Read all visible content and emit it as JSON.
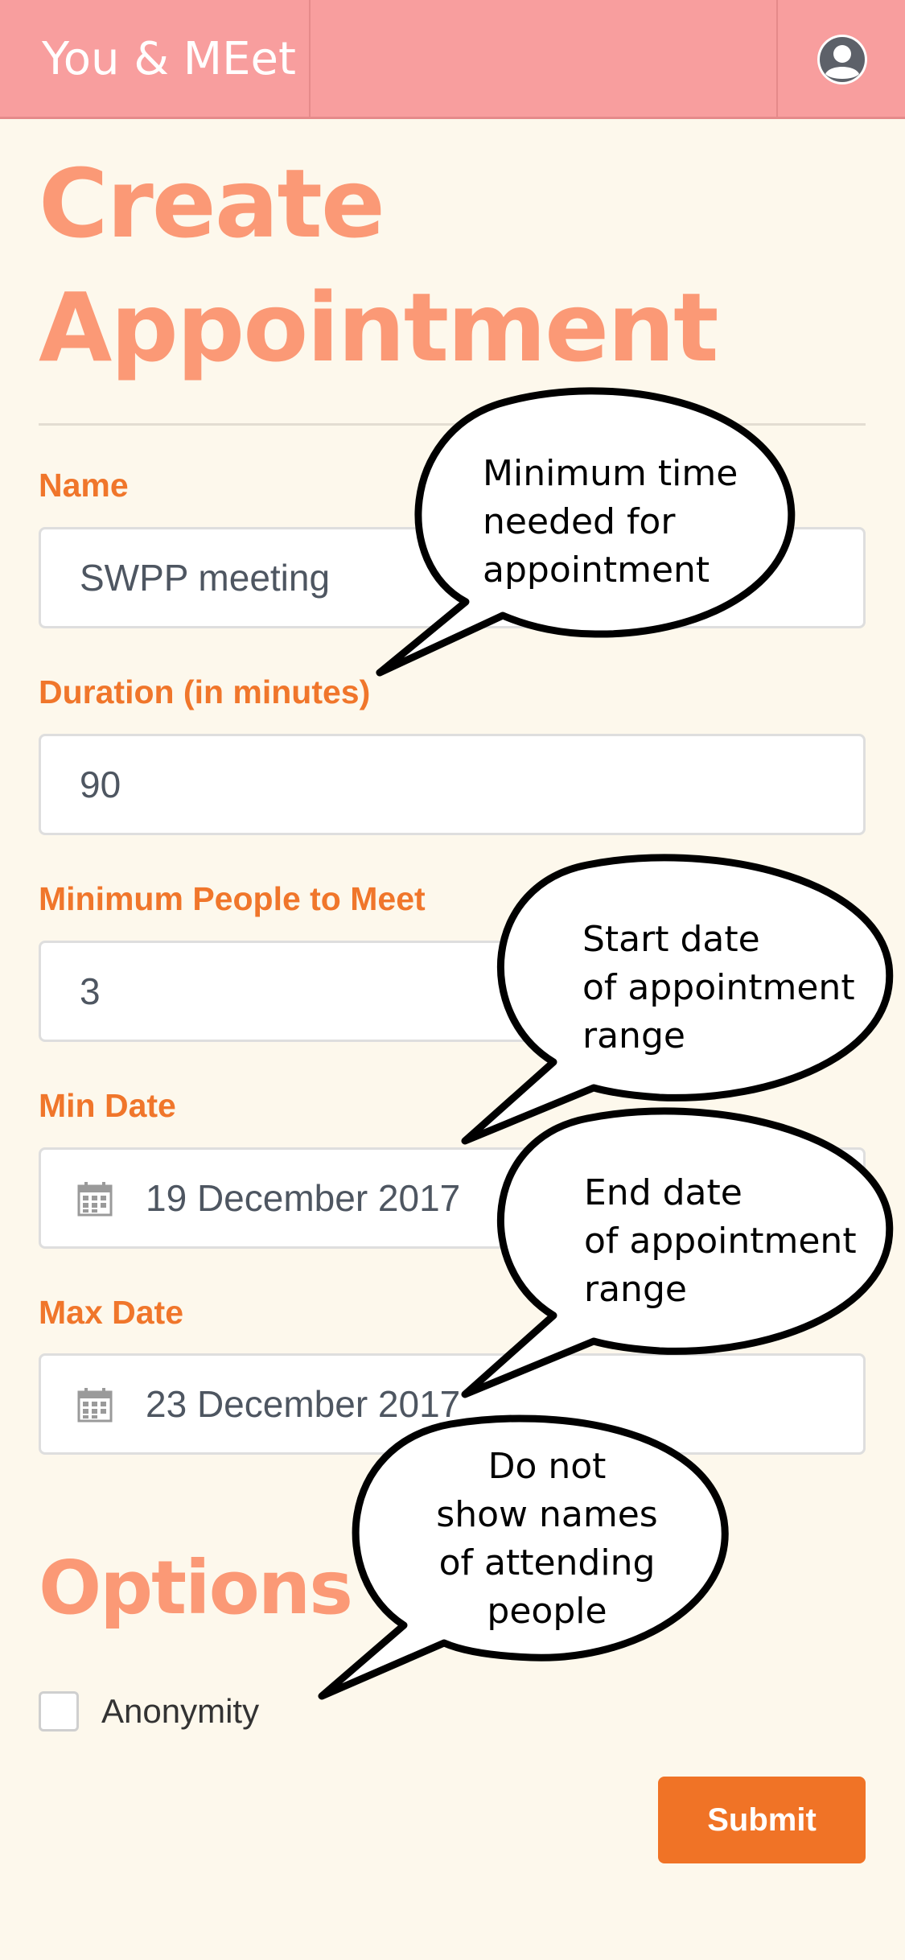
{
  "header": {
    "brand": "You & MEet",
    "avatar_icon": "user-avatar-icon"
  },
  "page": {
    "title_line1": "Create",
    "title_line2": "Appointment"
  },
  "form": {
    "name_label": "Name",
    "name_value": "SWPP meeting",
    "duration_label": "Duration (in minutes)",
    "duration_value": "90",
    "min_people_label": "Minimum People to Meet",
    "min_people_value": "3",
    "min_date_label": "Min Date",
    "min_date_value": "19 December 2017",
    "max_date_label": "Max Date",
    "max_date_value": "23 December 2017",
    "date_icon": "calendar-icon"
  },
  "options": {
    "title": "Options",
    "anonymity_label": "Anonymity",
    "anonymity_checked": false
  },
  "submit_label": "Submit",
  "annotations": {
    "duration_line1": "Minimum time",
    "duration_line2": "needed for",
    "duration_line3": "appointment",
    "min_date_line1": "Start date",
    "min_date_line2": "of appointment",
    "min_date_line3": "range",
    "max_date_line1": "End date",
    "max_date_line2": "of appointment",
    "max_date_line3": "range",
    "anonymity_line1": "Do not",
    "anonymity_line2": "show names",
    "anonymity_line3": "of attending",
    "anonymity_line4": "people"
  },
  "colors": {
    "navbar": "#f89e9e",
    "background": "#fdf8ec",
    "title": "#fb9976",
    "label": "#f0762b",
    "submit": "#f07326"
  }
}
